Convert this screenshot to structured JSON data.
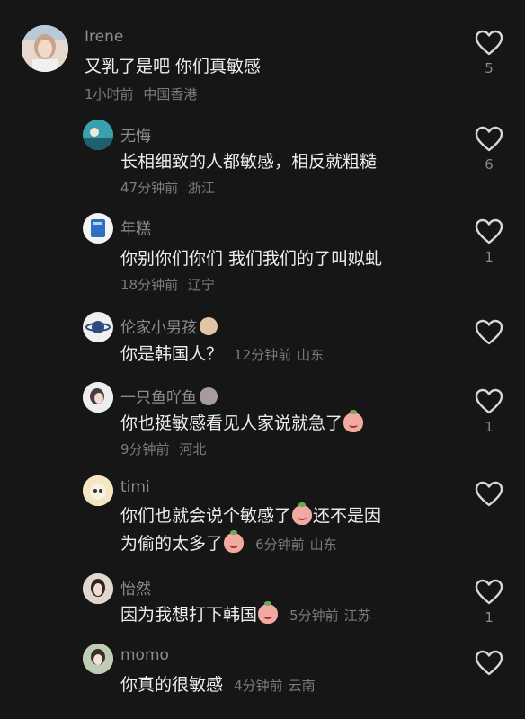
{
  "comments": [
    {
      "user": "Irene",
      "text": "又乳了是吧 你们真敏感",
      "time": "1小时前",
      "location": "中国香港",
      "likes": "5"
    },
    {
      "user": "无悔",
      "text": "长相细致的人都敏感，相反就粗糙",
      "time": "47分钟前",
      "location": "浙江",
      "likes": "6"
    },
    {
      "user": "年糕",
      "text": "你别你们你们 我们我们的了叫姒虬",
      "time": "18分钟前",
      "location": "辽宁",
      "likes": "1"
    },
    {
      "user": "伦家小男孩",
      "text": "你是韩国人？",
      "time": "12分钟前",
      "location": "山东",
      "likes": ""
    },
    {
      "user": "一只鱼吖鱼",
      "text": "你也挺敏感看见人家说就急了",
      "time": "9分钟前",
      "location": "河北",
      "likes": "1"
    },
    {
      "user": "timi",
      "text_line1": "你们也就会说个敏感了",
      "text_line1b": "还不是因",
      "text_line2": "为偷的太多了",
      "time": "6分钟前",
      "location": "山东",
      "likes": ""
    },
    {
      "user": "怡然",
      "text": "因为我想打下韩国",
      "time": "5分钟前",
      "location": "江苏",
      "likes": "1"
    },
    {
      "user": "momo",
      "text": "你真的很敏感",
      "time": "4分钟前",
      "location": "云南",
      "likes": ""
    }
  ],
  "colors": {
    "background": "#161616",
    "primary_text": "#ededed",
    "secondary_text": "#8d8d8d"
  }
}
